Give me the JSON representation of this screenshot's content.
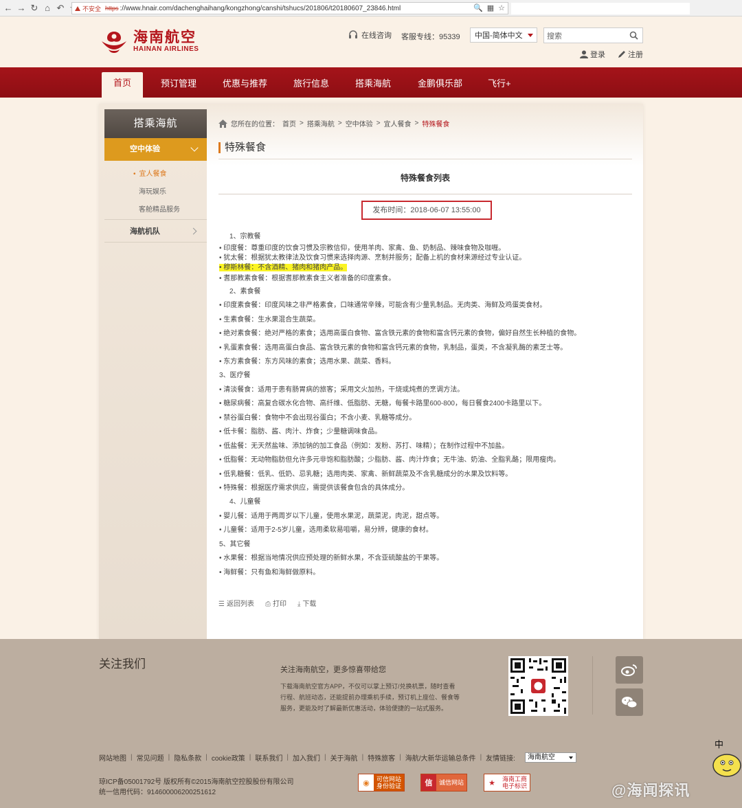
{
  "browser": {
    "nav_icons": [
      "back-icon",
      "forward-icon",
      "reload-icon",
      "home-icon",
      "undo-icon",
      "star-icon"
    ],
    "insecure_label": "不安全",
    "url_scheme": "https",
    "url_rest": "://www.hnair.com/dachenghaihang/kongzhong/canshi/tshucs/201806/t20180607_23846.html",
    "right_icons": [
      "zoom-icon",
      "qr-icon",
      "bookmark-star-icon"
    ]
  },
  "header": {
    "logo_cn": "海南航空",
    "logo_en": "HAINAN AIRLINES",
    "online_label": "在线咨询",
    "hotline_label": "客服专线：95339",
    "lang_value": "中国-简体中文",
    "search_placeholder": "搜索",
    "login_label": "登录",
    "register_label": "注册"
  },
  "nav": {
    "items": [
      {
        "label": "首页"
      },
      {
        "label": "预订管理"
      },
      {
        "label": "优惠与推荐"
      },
      {
        "label": "旅行信息"
      },
      {
        "label": "搭乘海航"
      },
      {
        "label": "金鹏俱乐部"
      },
      {
        "label": "飞行+"
      }
    ]
  },
  "sidebar": {
    "title": "搭乘海航",
    "category": "空中体验",
    "sub_items": [
      {
        "label": "宜人餐食"
      },
      {
        "label": "海玩娱乐"
      },
      {
        "label": "客舱精品服务"
      }
    ],
    "category2": "海航机队"
  },
  "breadcrumb": {
    "prefix": "您所在的位置：",
    "items": [
      "首页",
      "搭乘海航",
      "空中体验",
      "宜人餐食",
      "特殊餐食"
    ]
  },
  "article": {
    "page_title": "特殊餐食",
    "list_title": "特殊餐食列表",
    "publish_time": "发布时间：2018-06-07 13:55:00",
    "entries": [
      "1、宗教餐",
      "• 印度餐：尊重印度的饮食习惯及宗教信仰，使用羊肉、家禽、鱼、奶制品、辣味食物及咖喱。",
      "• 犹太餐：根据犹太教律法及饮食习惯来选择肉源、烹制并服务；配备上机的食材来源经过专业认证。",
      "• 穆斯林餐：不含酒精、猪肉和猪肉产品。",
      "• 耆那教素食餐：根据耆那教素食主义者准备的印度素食。",
      "2、素食餐",
      "• 印度素食餐：印度风味之非严格素食，口味通常辛辣，可能含有少量乳制品。无肉类、海鲜及鸡蛋类食材。",
      "• 生素食餐：生水果混合生蔬菜。",
      "• 绝对素食餐：绝对严格的素食；选用高蛋白食物、富含铁元素的食物和富含钙元素的食物，偏好自然生长种植的食物。",
      "• 乳蛋素食餐：选用高蛋白食品、富含铁元素的食物和富含钙元素的食物，乳制品，蛋类，不含凝乳酶的素芝士等。",
      "• 东方素食餐：东方风味的素食；选用水果、蔬菜、香料。",
      "3、医疗餐",
      "• 清淡餐食：适用于患有肠胃病的旅客；采用文火加热，干烧或炖煮的烹调方法。",
      "• 糖尿病餐：高复合碳水化合物、高纤维、低脂肪、无糖，每餐卡路里600-800，每日餐食2400卡路里以下。",
      "• 禁谷蛋白餐：食物中不会出现谷蛋白；不含小麦、乳糖等成分。",
      "• 低卡餐：脂肪、酱、肉汁、炸食；少量糖调味食品。",
      "• 低盐餐：无天然盐味、添加钠的加工食品（例如：发粉、苏打、味精）；在制作过程中不加盐。",
      "• 低脂餐：无动物脂肪但允许多元非饱和脂肪酸；少脂肪、酱、肉汁炸食；无牛油、奶油、全脂乳酪；限用瘦肉。",
      "• 低乳糖餐：低乳、低奶、忌乳糖；选用肉类、家禽、新鲜蔬菜及不含乳糖成分的水果及饮料等。",
      "• 特殊餐：根据医疗需求供应，需提供该餐食包含的具体成分。",
      "4、儿童餐",
      "• 婴儿餐：适用于两周岁以下儿童，使用水果泥，蔬菜泥，肉泥，甜点等。",
      "• 儿童餐：适用于2-5岁儿童，选用柔软易咀嚼，易分辨，健康的食材。",
      "5、其它餐",
      "• 水果餐：根据当地情况供应预处理的新鲜水果，不含亚硫酸盐的干果等。",
      "• 海鲜餐：只有鱼和海鲜做原料。"
    ],
    "actions": [
      "返回列表",
      "打印",
      "下载"
    ]
  },
  "footer": {
    "follow_title": "关注我们",
    "app_title": "关注海南航空，更多惊喜带给您",
    "app_desc": "下载海南航空官方APP，不仅可以掌上预订/兑换机票，随时查看行程、航班动态，还能提前办理乘机手续，预订机上座位、餐食等服务，更能及时了解最新优惠活动，体验便捷的一站式服务。",
    "links": [
      "网站地图",
      "常见问题",
      "隐私条款",
      "cookie政策",
      "联系我们",
      "加入我们",
      "关于海航",
      "特殊旅客",
      "海航/大新华运输总条件"
    ],
    "friend_label": "友情链接:",
    "friend_value": "海南航空",
    "copyright": "琼ICP备05001792号 版权所有©2015海南航空控股股份有限公司",
    "credit_code": "统一信用代码：914600006200251612",
    "badges": [
      {
        "line1": "可信网站",
        "line2": "身份验证",
        "icon": "trusted-site-icon"
      },
      {
        "line1": "诚信网站",
        "line2": "",
        "icon": "credit-site-icon"
      },
      {
        "line1": "海南工商",
        "line2": "电子标识",
        "icon": "business-license-icon"
      }
    ],
    "social_icons": [
      "weibo-icon",
      "wechat-icon"
    ]
  },
  "overlay": {
    "watermark": "@海闻探讯",
    "mascot_label": "中"
  },
  "colors": {
    "brand_red": "#b4161c",
    "accent_orange": "#dd9a1e",
    "highlight_yellow": "#fbf424",
    "footer_bg": "#bcaea0"
  }
}
